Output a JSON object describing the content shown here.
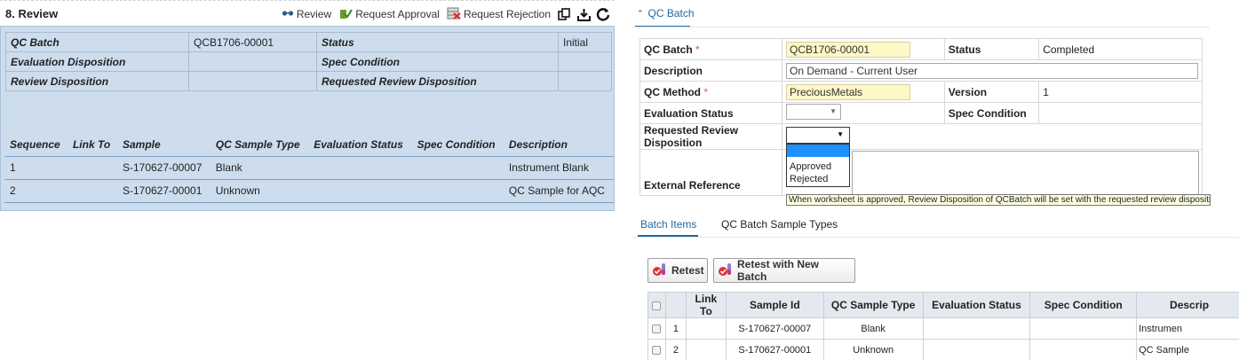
{
  "left": {
    "title": "8.  Review",
    "toolbar": {
      "review_label": "Review",
      "request_approval_label": "Request Approval",
      "request_rejection_label": "Request Rejection"
    },
    "info": [
      {
        "label": "QC Batch",
        "value": "QCB1706-00001",
        "label2": "Status",
        "value2": "Initial"
      },
      {
        "label": "Evaluation Disposition",
        "value": "",
        "label2": "Spec Condition",
        "value2": ""
      },
      {
        "label": "Review Disposition",
        "value": "",
        "label2": "Requested Review Disposition",
        "value2": ""
      }
    ],
    "items_columns": [
      "Sequence",
      "Link To",
      "Sample",
      "QC Sample Type",
      "Evaluation Status",
      "Spec Condition",
      "Description"
    ],
    "items": [
      {
        "sequence": "1",
        "link_to": "",
        "sample": "S-170627-00007",
        "qc_sample_type": "Blank",
        "evaluation_status": "",
        "spec_condition": "",
        "description": "Instrument Blank"
      },
      {
        "sequence": "2",
        "link_to": "",
        "sample": "S-170627-00001",
        "qc_sample_type": "Unknown",
        "evaluation_status": "",
        "spec_condition": "",
        "description": "QC Sample for AQC"
      }
    ]
  },
  "right": {
    "section_title": "QC Batch",
    "form": {
      "qc_batch_label": "QC Batch",
      "qc_batch_value": "QCB1706-00001",
      "status_label": "Status",
      "status_value": "Completed",
      "description_label": "Description",
      "description_value": "On Demand - Current User",
      "qc_method_label": "QC Method",
      "qc_method_value": "PreciousMetals",
      "version_label": "Version",
      "version_value": "1",
      "evaluation_status_label": "Evaluation Status",
      "spec_condition_label": "Spec Condition",
      "requested_review_label": "Requested Review Disposition",
      "external_reference_label": "External Reference",
      "required_marker": "*"
    },
    "dropdown_options": [
      "Approved",
      "Rejected"
    ],
    "tooltip": "When worksheet is approved, Review Disposition of QCBatch will be set with the requested review disposition value.",
    "tabs": [
      "Batch Items",
      "QC Batch Sample Types"
    ],
    "buttons": {
      "retest": "Retest",
      "retest_new_batch": "Retest with New Batch"
    },
    "grid_columns": [
      "",
      "",
      "Link To",
      "Sample Id",
      "QC Sample Type",
      "Evaluation Status",
      "Spec Condition",
      "Descrip"
    ],
    "grid_rows": [
      {
        "num": "1",
        "link_to": "",
        "sample_id": "S-170627-00007",
        "qc_sample_type": "Blank",
        "evaluation_status": "",
        "spec_condition": "",
        "description": "Instrumen"
      },
      {
        "num": "2",
        "link_to": "",
        "sample_id": "S-170627-00001",
        "qc_sample_type": "Unknown",
        "evaluation_status": "",
        "spec_condition": "",
        "description": "QC Sample"
      }
    ]
  },
  "colors": {
    "accent": "#1f6aa5",
    "panel_bg": "#cdddee",
    "required_input_bg": "#fdf8c6",
    "required_marker": "#d9534f",
    "tooltip_bg": "#ffffe1"
  }
}
